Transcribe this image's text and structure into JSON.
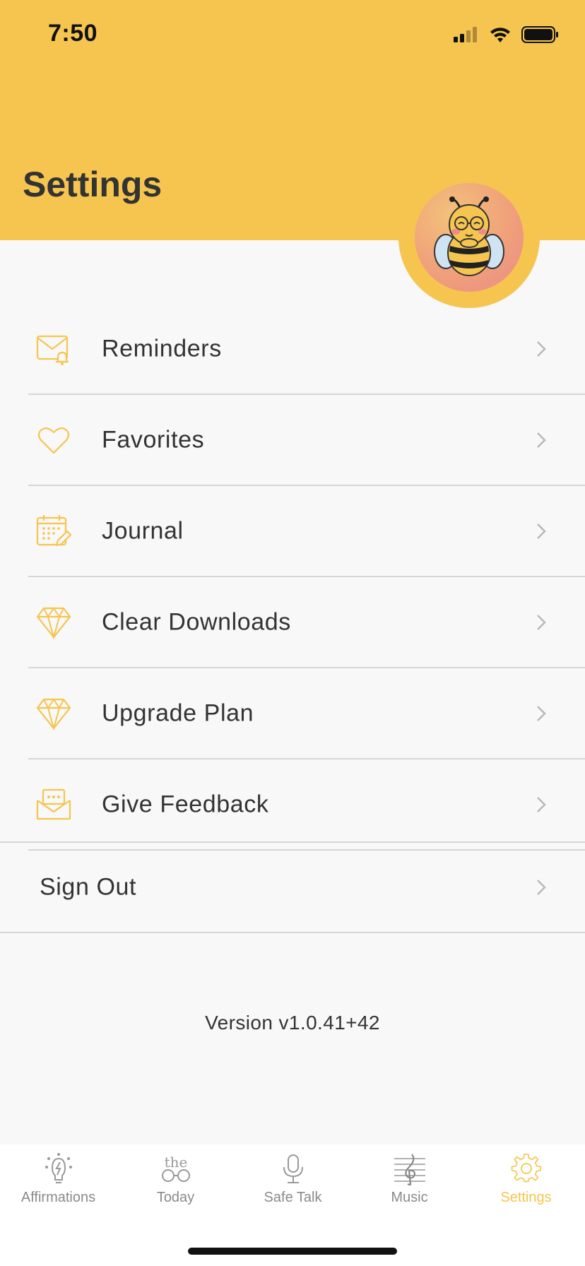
{
  "status_bar": {
    "time": "7:50"
  },
  "header": {
    "title": "Settings"
  },
  "menu": {
    "items": [
      {
        "label": "Reminders",
        "icon": "mail-bell-icon"
      },
      {
        "label": "Favorites",
        "icon": "heart-icon"
      },
      {
        "label": "Journal",
        "icon": "calendar-pencil-icon"
      },
      {
        "label": "Clear Downloads",
        "icon": "diamond-icon"
      },
      {
        "label": "Upgrade Plan",
        "icon": "diamond-icon"
      },
      {
        "label": "Give Feedback",
        "icon": "feedback-envelope-icon"
      }
    ],
    "sign_out": "Sign Out"
  },
  "version": "Version v1.0.41+42",
  "tabs": [
    {
      "label": "Affirmations",
      "icon": "bulb-icon"
    },
    {
      "label": "Today",
      "icon": "today-icon"
    },
    {
      "label": "Safe Talk",
      "icon": "microphone-icon"
    },
    {
      "label": "Music",
      "icon": "music-clef-icon"
    },
    {
      "label": "Settings",
      "icon": "gear-icon",
      "active": true
    }
  ],
  "colors": {
    "accent": "#f5c54f",
    "text": "#333333",
    "inactive_tab": "#8a8a8a",
    "background": "#f8f8f8"
  }
}
